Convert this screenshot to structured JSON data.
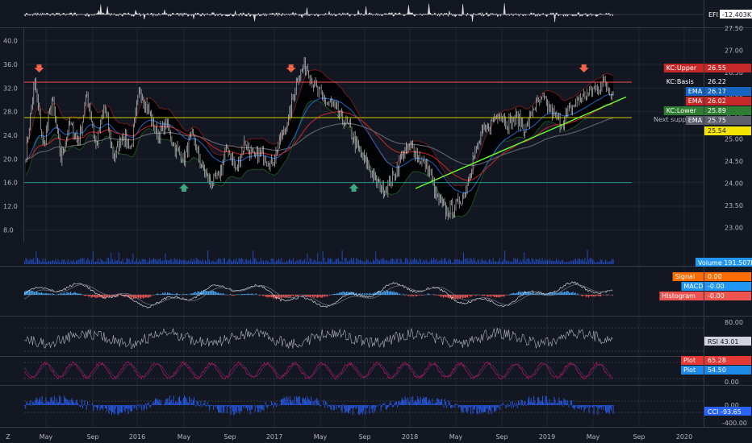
{
  "colors": {
    "bg": "#131722",
    "grid": "#2a2e39",
    "text": "#b2b5be",
    "red": "#ef5350",
    "green": "#26a69a",
    "blue": "#2962ff",
    "lime": "#66ff33",
    "yellow": "#c8c800",
    "orange": "#ff9800",
    "gray": "#787b86",
    "pink": "#ad1457",
    "white": "#ffffff"
  },
  "chart_data": [
    {
      "type": "area",
      "pane": "efi",
      "legend": "EFI",
      "value_label": "-12.403K"
    },
    {
      "type": "line",
      "pane": "main",
      "left_axis_ticks": [
        "40.0",
        "36.0",
        "32.0",
        "28.0",
        "24.0",
        "20.0",
        "16.0",
        "12.0",
        "8.0"
      ],
      "left_axis_values": [
        40,
        36,
        32,
        28,
        24,
        20,
        16,
        12,
        8
      ],
      "right_axis_ticks": [
        "27.50",
        "27.00",
        "26.50",
        "26.00",
        "25.50",
        "25.00",
        "24.50",
        "24.00",
        "23.50",
        "23.00"
      ],
      "ylim": [
        6,
        42
      ],
      "x_ticks": [
        "May",
        "Sep",
        "2016",
        "May",
        "Sep",
        "2017",
        "May",
        "Sep",
        "2018",
        "May",
        "Sep",
        "2019",
        "May",
        "Sep",
        "2020"
      ],
      "series": [
        {
          "name": "KC:Upper",
          "value": "26.55",
          "color": "#c62828"
        },
        {
          "name": "KC:Basis",
          "value": "26.22",
          "color": "#131722"
        },
        {
          "name": "EMA",
          "value": "26.17",
          "color": "#1565c0"
        },
        {
          "name": "EMA",
          "value": "26.02",
          "color": "#c62828"
        },
        {
          "name": "KC:Lower",
          "value": "25.89",
          "color": "#2e7d32"
        },
        {
          "name": "EMA",
          "value": "25.75",
          "color": "#5d606b"
        }
      ],
      "price_tag": "25.54",
      "horizontal_levels": [
        {
          "price": 33.0,
          "color": "#ef5350",
          "note": ""
        },
        {
          "price": 27.0,
          "color": "#c8c800",
          "note": "Next support"
        },
        {
          "price": 16.0,
          "color": "#26a69a",
          "note": ""
        }
      ],
      "trendline": {
        "from_x": "2018",
        "from_price": 15.0,
        "to_x": "2019-06",
        "to_price": 31.0
      },
      "arrows_down": [
        0.02,
        0.45,
        0.95
      ],
      "arrows_up": [
        0.27,
        0.56
      ],
      "close_path": [
        21,
        33,
        22,
        30,
        20,
        26,
        23,
        31,
        22,
        29,
        20,
        24,
        22,
        32,
        28,
        24,
        26,
        22,
        20,
        24,
        19,
        16,
        17,
        22,
        18,
        23,
        20,
        21,
        19,
        23,
        27,
        34,
        36,
        32,
        30,
        29,
        27,
        25,
        21,
        19,
        16,
        15,
        17,
        21,
        22,
        20,
        18,
        13,
        11,
        12,
        14,
        20,
        24,
        26,
        28,
        26,
        27,
        25,
        29,
        30,
        28,
        26,
        28,
        30,
        31,
        32,
        33,
        31
      ]
    },
    {
      "type": "bar",
      "pane": "volume",
      "legend": "Volume",
      "value_label": "191.507K"
    },
    {
      "type": "line",
      "pane": "macd",
      "series": [
        {
          "name": "Signal",
          "value": "0.00",
          "color": "#ff6d00"
        },
        {
          "name": "MACD",
          "value": "-0.00",
          "color": "#2196f3"
        },
        {
          "name": "Histogram",
          "value": "-0.00",
          "color": "#ef5350"
        }
      ]
    },
    {
      "type": "line",
      "pane": "rsi",
      "legend": "RSI",
      "value_label": "43.01",
      "ticks": [
        "80.00"
      ]
    },
    {
      "type": "line",
      "pane": "stoch",
      "series": [
        {
          "name": "Plot",
          "value": "65.28",
          "color": "#e53935"
        },
        {
          "name": "Plot",
          "value": "54.50",
          "color": "#1e88e5"
        }
      ],
      "ticks": [
        "0.00"
      ]
    },
    {
      "type": "bar",
      "pane": "cci",
      "legend": "CCI",
      "value_label": "-93.65",
      "ticks": [
        "0.00",
        "-400.00"
      ]
    }
  ]
}
